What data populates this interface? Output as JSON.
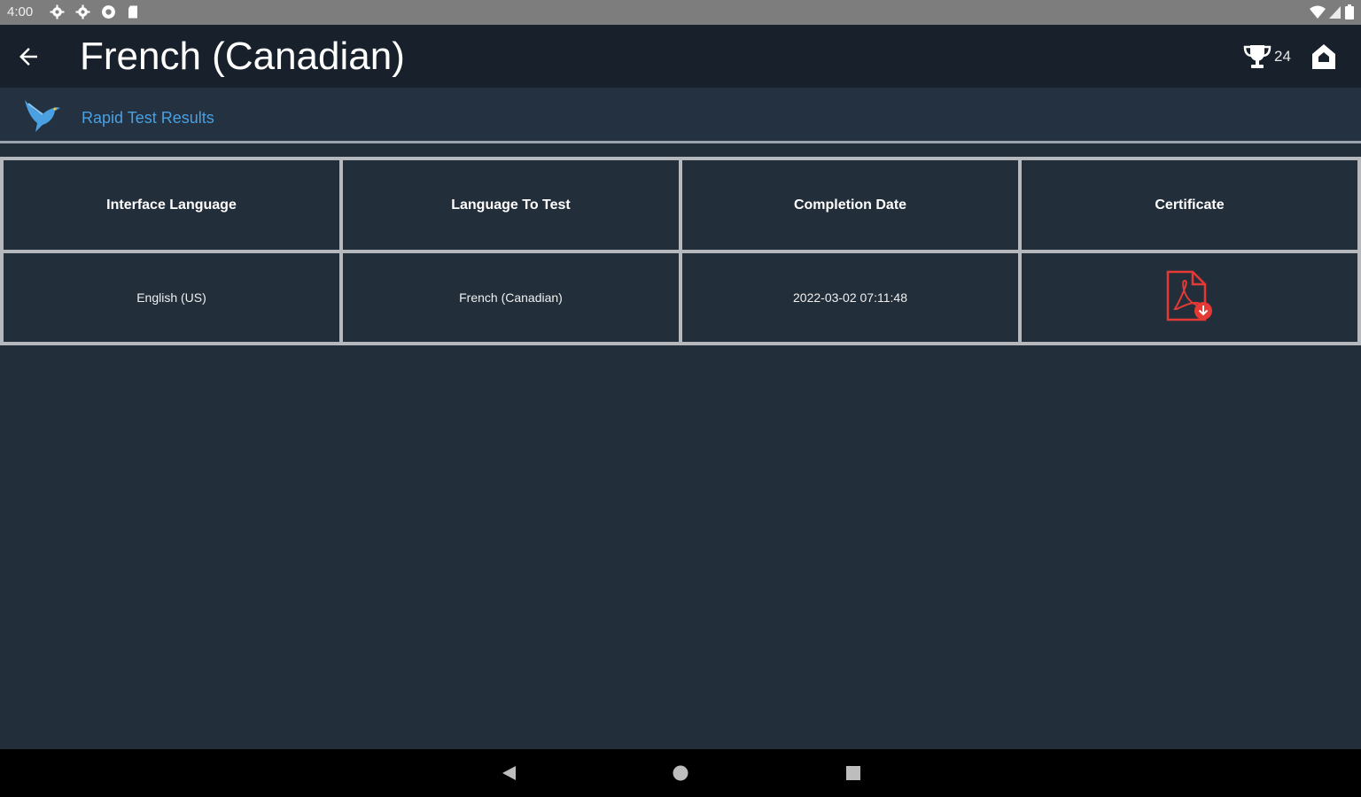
{
  "status_bar": {
    "time": "4:00"
  },
  "app_bar": {
    "title": "French (Canadian)",
    "trophy_count": "24"
  },
  "sub_header": {
    "title": "Rapid Test Results"
  },
  "table": {
    "headers": [
      "Interface Language",
      "Language To Test",
      "Completion Date",
      "Certificate"
    ],
    "rows": [
      {
        "interface_language": "English (US)",
        "language_to_test": "French (Canadian)",
        "completion_date": "2022-03-02 07:11:48",
        "certificate_icon": "pdf-certificate-icon"
      }
    ]
  },
  "icons": {
    "back": "arrow-left-icon",
    "trophy": "trophy-icon",
    "home": "home-icon",
    "logo": "bird-logo-icon",
    "nav_back": "triangle-back-icon",
    "nav_home": "circle-home-icon",
    "nav_recents": "square-recents-icon"
  },
  "colors": {
    "background": "#232e3b",
    "app_bar": "#18202b",
    "sub_header_text": "#4aa0e0",
    "pdf_red": "#e53935",
    "table_border": "#b5b8bc"
  }
}
